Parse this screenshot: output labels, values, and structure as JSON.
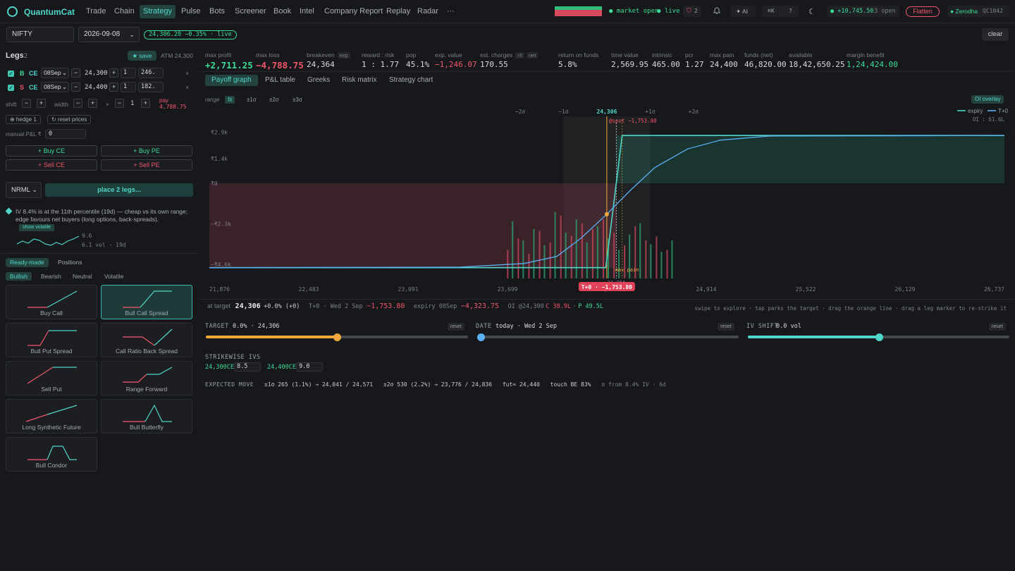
{
  "app": {
    "brand": "QuantumCat"
  },
  "nav": [
    "Trade",
    "Chain",
    "Strategy",
    "Pulse",
    "Bots",
    "Screener",
    "Book",
    "Intel",
    "Company Report",
    "Replay",
    "Radar",
    "···"
  ],
  "nav_active": 2,
  "topbar": {
    "market_status": "● market open",
    "live": "● live",
    "notif_count": "2",
    "ai_label": "✦ AI",
    "shortcut": "⌘K",
    "help": "?",
    "pnl": "● +10,745.50",
    "open_count": "3 open",
    "flatten": "Flatten",
    "broker": "● Zerodha",
    "account": "QC1042"
  },
  "symbol": {
    "name": "NIFTY",
    "expiry": "2026-09-08",
    "price_badge": "24,306.20 −0.35% · live",
    "clear": "clear"
  },
  "legs": {
    "title": "Legs",
    "count": "2",
    "save": "★ save",
    "atm": "ATM 24,300",
    "rows": [
      {
        "side": "B",
        "type": "CE",
        "expiry": "08Sep",
        "strike": "24,300",
        "qty": "1",
        "price": "246.",
        "remove": "×"
      },
      {
        "side": "S",
        "type": "CE",
        "expiry": "08Sep",
        "strike": "24,400",
        "qty": "1",
        "price": "182.",
        "remove": "×"
      }
    ],
    "shift_label": "shift",
    "width_label": "width",
    "width_value": "1",
    "times": "×",
    "pay_label": "pay",
    "pay_value": "4,788.75",
    "hedge": "⊕ hedge 1",
    "reset_prices": "↻ reset prices",
    "manual_pnl_label": "manual P&L ₹",
    "manual_pnl_value": "0",
    "buy_ce": "+ Buy CE",
    "buy_pe": "+ Buy PE",
    "sell_ce": "+ Sell CE",
    "sell_pe": "+ Sell PE",
    "product": "NRML",
    "place": "place 2 legs...",
    "iv_note": "IV 8.4% is at the 11th percentile (19d) — cheap vs its own range; edge favours net buyers (long options, back-spreads).",
    "show_volatile": "show volatile",
    "iv_high": "9.6",
    "iv_low": "6.1 vol · 19d"
  },
  "readymade": {
    "tabs": [
      "Ready-made",
      "Positions"
    ],
    "filters": [
      "Bullish",
      "Bearish",
      "Neutral",
      "Volatile"
    ],
    "cards": [
      "Buy Call",
      "Bull Call Spread",
      "Bull Put Spread",
      "Call Ratio Back Spread",
      "Sell Put",
      "Range Forward",
      "Long Synthetic Future",
      "Bull Butterfly",
      "Bull Condor"
    ]
  },
  "stats": [
    {
      "k": "max profit",
      "v": "+2,711.25"
    },
    {
      "k": "max loss",
      "v": "−4,788.75"
    },
    {
      "k": "breakeven",
      "tag": "exp",
      "v": "24,364"
    },
    {
      "k": "reward : risk",
      "v": "1 : 1.77"
    },
    {
      "k": "pop",
      "v": "45.1%"
    },
    {
      "k": "exp. value",
      "v": "−1,246.07"
    },
    {
      "k": "est. charges",
      "tag": "r/t",
      "tag2": "net",
      "v": "170.55"
    },
    {
      "k": "return on funds",
      "v": "5.8%"
    },
    {
      "k": "time value",
      "v": "2,569.95"
    },
    {
      "k": "intrinsic",
      "v": "465.00"
    },
    {
      "k": "pcr",
      "v": "1.27"
    },
    {
      "k": "max pain",
      "v": "24,400"
    },
    {
      "k": "funds (net)",
      "v": "46,820.00"
    },
    {
      "k": "available",
      "v": "18,42,650.25"
    },
    {
      "k": "margin benefit",
      "v": "1,24,424.00"
    }
  ],
  "tabs": [
    "Payoff graph",
    "P&L table",
    "Greeks",
    "Risk matrix",
    "Strategy chart"
  ],
  "oi_overlay": "OI overlay",
  "range": {
    "label": "range",
    "options": [
      "fit",
      "±1σ",
      "±2σ",
      "±3σ"
    ]
  },
  "chart": {
    "sigma_labels": [
      "−2σ",
      "−1σ",
      "24,306",
      "+1σ",
      "+2σ"
    ],
    "legend": [
      "expiry",
      "T+0"
    ],
    "oi_note": "OI : 61.6L",
    "spot_label": "@spot −1,753.80",
    "max_pain_label": "max pain",
    "hover_label": "T+0 · −1,753.80",
    "hover_strike": "24,364"
  },
  "chart_data": {
    "type": "line",
    "x_range": [
      21876,
      26737
    ],
    "y_range": [
      -5400,
      3600
    ],
    "x_ticks": [
      "21,876",
      "22,483",
      "23,091",
      "23,699",
      "24,306",
      "24,914",
      "25,522",
      "26,129",
      "26,737"
    ],
    "y_ticks": [
      "₹2.9k",
      "₹1.4k",
      "₹0",
      "−₹2.3k",
      "−₹4.6k"
    ],
    "y_tick_values": [
      2900,
      1400,
      0,
      -2300,
      -4600
    ],
    "series": [
      {
        "name": "expiry",
        "x": [
          21876,
          24300,
          24400,
          26737
        ],
        "y": [
          -4788.75,
          -4788.75,
          2711.25,
          2711.25
        ]
      },
      {
        "name": "T+0",
        "x": [
          21876,
          23400,
          23800,
          24000,
          24150,
          24306,
          24450,
          24600,
          24800,
          25000,
          25300,
          26737
        ],
        "y": [
          -4788,
          -4760,
          -4550,
          -4150,
          -3100,
          -1753.8,
          -400,
          900,
          1950,
          2450,
          2680,
          2711
        ]
      }
    ],
    "spot": 24306,
    "breakeven": 24364,
    "max_pain": 24400,
    "oi_call": [
      30,
      42,
      26,
      50,
      38,
      66,
      45,
      58,
      52,
      62,
      48,
      35,
      55,
      40,
      44,
      30
    ],
    "oi_put": [
      60,
      40,
      52,
      35,
      70,
      48,
      62,
      38,
      55,
      42,
      30,
      46,
      58,
      36,
      28,
      40
    ]
  },
  "target_line": {
    "at_target_label": "at target",
    "at_target_value": "24,306",
    "at_target_change": "+0.0% (+0)",
    "t0_label": "T+0 · Wed 2 Sep",
    "t0_value": "−1,753.80",
    "expiry_label": "expiry 08Sep",
    "expiry_value": "−4,323.75",
    "oi_label": "OI @24,300",
    "oi_c": "C 38.9L",
    "oi_dot": "·",
    "oi_p": "P 49.5L",
    "hint": "swipe to explore · tap parks the target · drag the orange line · drag a leg marker to re-strike it"
  },
  "sliders": {
    "target_label": "TARGET",
    "target_value": "0.0% · 24,306",
    "target_pct": 0.5,
    "date_label": "DATE",
    "date_value": "today · Wed 2 Sep",
    "date_pct": 0.0,
    "iv_label": "IV SHIFT",
    "iv_value": "0.0 vol",
    "iv_pct": 0.5,
    "reset": "reset"
  },
  "strikewise": {
    "label": "STRIKEWISE IVS",
    "items": [
      {
        "strike": "24,300CE",
        "iv": "8.5"
      },
      {
        "strike": "24,400CE",
        "iv": "9.0"
      }
    ]
  },
  "expected_move": {
    "label": "EXPECTED MOVE",
    "s1": "±1σ 265 (1.1%) → 24,041 / 24,571",
    "s2": "±2σ 530 (2.2%) → 23,776 / 24,836",
    "fut": "fut≈ 24,440",
    "touch": "touch BE 83%",
    "src": "σ from 8.4% IV · 6d"
  },
  "colors": {
    "accent": "#4fd6c8",
    "green": "#3ddc97",
    "red": "#f0566b",
    "orange": "#f0a93a",
    "t0": "#5ab1f5"
  }
}
